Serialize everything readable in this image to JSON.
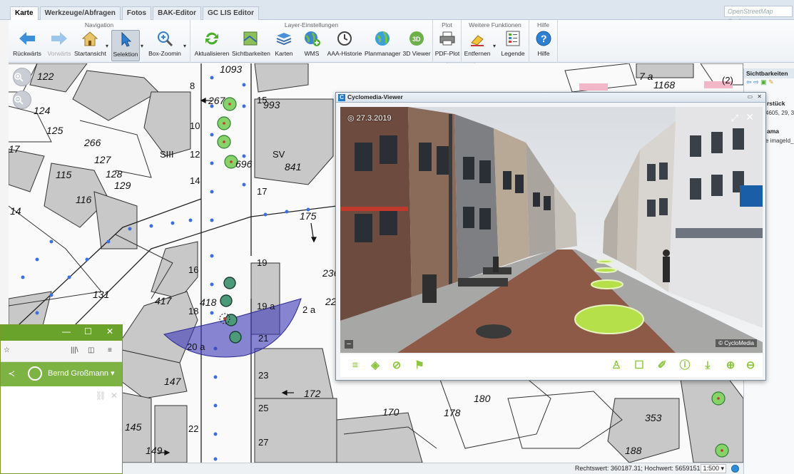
{
  "tabs": [
    "Karte",
    "Werkzeuge/Abfragen",
    "Fotos",
    "BAK-Editor",
    "GC LIS Editor"
  ],
  "active_tab": "Karte",
  "osm_search_placeholder": "OpenStreetMap Suche",
  "ribbon": {
    "groups": {
      "navigation": "Navigation",
      "layer": "Layer-Einstellungen",
      "plot": "Plot",
      "weitere": "Weitere Funktionen",
      "hilfe": "Hilfe"
    },
    "buttons": {
      "back": "Rückwärts",
      "forward": "Vorwärts",
      "home": "Startansicht",
      "select": "Selektion",
      "boxzoom": "Box-Zoomin",
      "refresh": "Aktualisieren",
      "visibility": "Sichtbarkeiten",
      "maps": "Karten",
      "wms": "WMS",
      "aaa": "AAA-Historie",
      "planmanager": "Planmanager",
      "viewer3d": "3D Viewer",
      "pdfplot": "PDF-Plot",
      "remove": "Entfernen",
      "legend": "Legende",
      "help": "Hilfe"
    }
  },
  "map_labels": [
    {
      "text": "122"
    },
    {
      "text": "124"
    },
    {
      "text": "125"
    },
    {
      "text": "17"
    },
    {
      "text": "266"
    },
    {
      "text": "127"
    },
    {
      "text": "128"
    },
    {
      "text": "129"
    },
    {
      "text": "115"
    },
    {
      "text": "116"
    },
    {
      "text": "14"
    },
    {
      "text": "1093"
    },
    {
      "text": "267"
    },
    {
      "text": "993"
    },
    {
      "text": "SIII"
    },
    {
      "text": "SV"
    },
    {
      "text": "841"
    },
    {
      "text": "696"
    },
    {
      "text": "175"
    },
    {
      "text": "236"
    },
    {
      "text": "131"
    },
    {
      "text": "417"
    },
    {
      "text": "418"
    },
    {
      "text": "2 a"
    },
    {
      "text": "22"
    },
    {
      "text": "147"
    },
    {
      "text": "172"
    },
    {
      "text": "170"
    },
    {
      "text": "178"
    },
    {
      "text": "180"
    },
    {
      "text": "145"
    },
    {
      "text": "149"
    },
    {
      "text": "353"
    },
    {
      "text": "188"
    },
    {
      "text": "7 a"
    },
    {
      "text": "1168"
    },
    {
      "text": "(2)"
    },
    {
      "text": "19"
    },
    {
      "text": "19 a"
    },
    {
      "text": "21"
    },
    {
      "text": "23"
    },
    {
      "text": "25"
    },
    {
      "text": "27"
    },
    {
      "text": "16"
    },
    {
      "text": "18"
    },
    {
      "text": "20 a"
    },
    {
      "text": "22"
    },
    {
      "text": "15"
    },
    {
      "text": "17"
    },
    {
      "text": "10"
    },
    {
      "text": "12"
    },
    {
      "text": "14"
    },
    {
      "text": "8"
    }
  ],
  "status": {
    "coords": "Rechtswert: 360187.31; Hochwert: 5659151.05",
    "scale": "1:500"
  },
  "sidepanel": {
    "title": "Sichtbarkeiten",
    "section1": "rstück",
    "value1": "4605, 29, 3",
    "section2": "ama",
    "value2": "e imageId_"
  },
  "viewer": {
    "title": "Cyclomedia-Viewer",
    "date": "27.3.2019",
    "credit": "© CycloMedia"
  },
  "browser": {
    "user": "Bernd Großmann"
  }
}
